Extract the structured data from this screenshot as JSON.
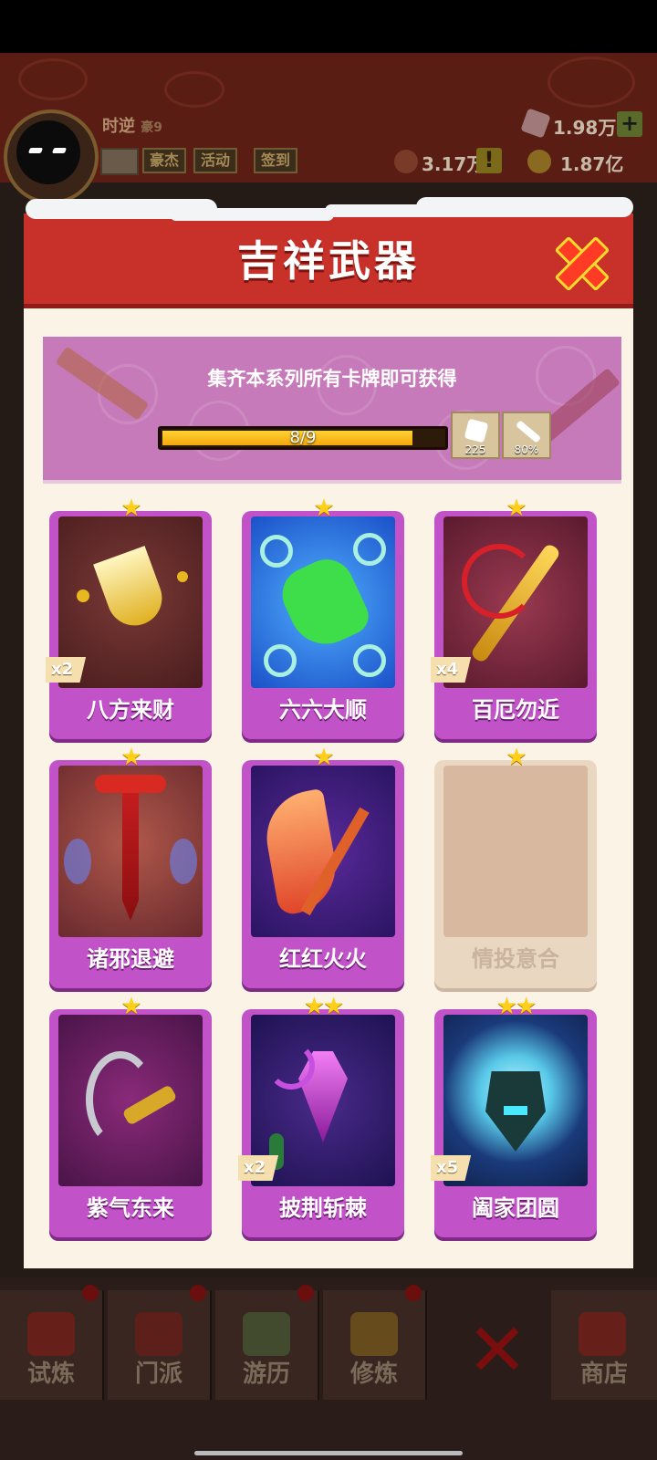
{
  "header": {
    "player_name": "时逆",
    "player_badge": "豪9",
    "buttons": [
      {
        "label": "豪杰"
      },
      {
        "label": "活动"
      },
      {
        "label": "签到"
      }
    ],
    "resources": {
      "gems": "1.98万",
      "power": "3.17万",
      "coins": "1.87亿"
    }
  },
  "modal": {
    "title": "吉祥武器",
    "banner_text": "集齐本系列所有卡牌即可获得",
    "progress": {
      "current": 8,
      "total": 9,
      "label": "8/9"
    },
    "rewards": [
      {
        "icon": "dice-icon",
        "value": "225"
      },
      {
        "icon": "sword-icon",
        "value": "80%"
      }
    ]
  },
  "cards": [
    {
      "name": "八方来财",
      "stars": "★",
      "count": "x2",
      "locked": false
    },
    {
      "name": "六六大顺",
      "stars": "★",
      "count": "",
      "locked": false
    },
    {
      "name": "百厄勿近",
      "stars": "★",
      "count": "x4",
      "locked": false
    },
    {
      "name": "诸邪退避",
      "stars": "★",
      "count": "",
      "locked": false
    },
    {
      "name": "红红火火",
      "stars": "★",
      "count": "",
      "locked": false
    },
    {
      "name": "情投意合",
      "stars": "★",
      "count": "",
      "locked": true
    },
    {
      "name": "紫气东来",
      "stars": "★",
      "count": "",
      "locked": false
    },
    {
      "name": "披荆斩棘",
      "stars": "★★",
      "count": "x2",
      "locked": false
    },
    {
      "name": "阖家团圆",
      "stars": "★★",
      "count": "x5",
      "locked": false
    }
  ],
  "bottom_nav": [
    {
      "label": "试炼"
    },
    {
      "label": "门派"
    },
    {
      "label": "游历"
    },
    {
      "label": "修炼"
    },
    {
      "label": "商店"
    }
  ],
  "colors": {
    "modal_header": "#c8312a",
    "card_frame": "#c152c8",
    "banner": "#c67ab9",
    "progress_fill": "#f4a70c"
  }
}
